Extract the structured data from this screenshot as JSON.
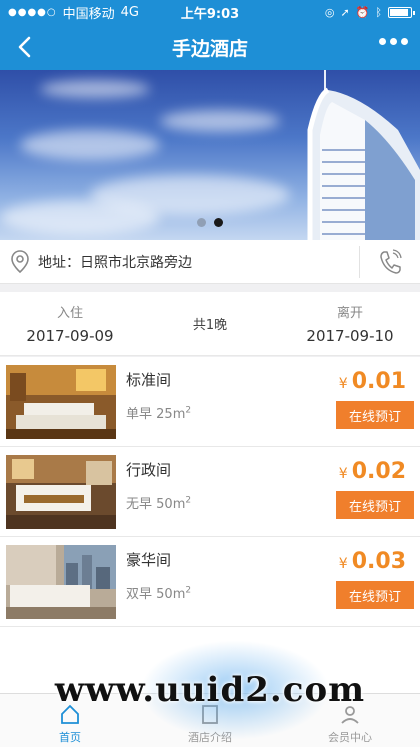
{
  "status_bar": {
    "carrier": "中国移动",
    "network": "4G",
    "time": "上午9:03"
  },
  "nav": {
    "title": "手边酒店",
    "back_icon": "chevron-left-icon",
    "more_icon": "more-dots-icon"
  },
  "banner": {
    "slide_count": 2,
    "active_slide": 2
  },
  "address": {
    "label": "地址：",
    "value": "日照市北京路旁边",
    "pin_icon": "location-pin-icon",
    "phone_icon": "phone-icon"
  },
  "stay": {
    "checkin_label": "入住",
    "checkin_date": "2017-09-09",
    "nights": "共1晚",
    "checkout_label": "离开",
    "checkout_date": "2017-09-10"
  },
  "rooms": [
    {
      "name": "标准间",
      "breakfast": "单早",
      "area": "25m",
      "currency": "¥",
      "price": "0.01",
      "button": "在线预订"
    },
    {
      "name": "行政间",
      "breakfast": "无早",
      "area": "50m",
      "currency": "¥",
      "price": "0.02",
      "button": "在线预订"
    },
    {
      "name": "豪华间",
      "breakfast": "双早",
      "area": "50m",
      "currency": "¥",
      "price": "0.03",
      "button": "在线预订"
    }
  ],
  "area_unit_sup": "2",
  "tabs": [
    {
      "label": "首页"
    },
    {
      "label": "酒店介绍"
    },
    {
      "label": "会员中心"
    }
  ],
  "watermark": "www.uuid2.com",
  "colors": {
    "primary": "#1e8fd6",
    "accent": "#f07f2c",
    "price": "#f08a24"
  }
}
